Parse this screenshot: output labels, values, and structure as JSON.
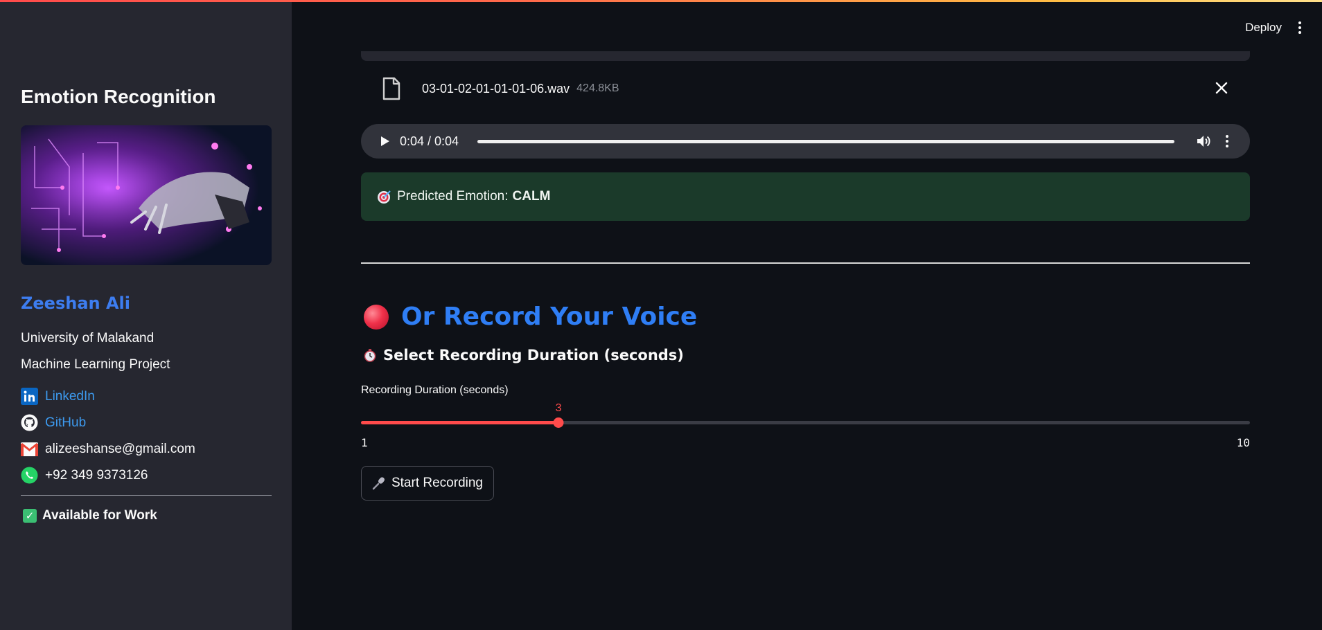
{
  "sidebar": {
    "title": "Emotion Recognition",
    "name": "Zeeshan Ali",
    "university": "University of Malakand",
    "project": "Machine Learning Project",
    "links": {
      "linkedin": "LinkedIn",
      "github": "GitHub",
      "email": "alizeeshanse@gmail.com",
      "phone": "+92 349 9373126"
    },
    "availability": "Available for Work"
  },
  "header": {
    "deploy_label": "Deploy"
  },
  "uploader": {
    "file_name": "03-01-02-01-01-01-06.wav",
    "file_size": "424.8KB"
  },
  "audio": {
    "time": "0:04 / 0:04",
    "progress_fraction": 1.0
  },
  "prediction": {
    "label": "Predicted Emotion:",
    "value": "CALM"
  },
  "record": {
    "heading": "Or Record Your Voice",
    "subheading": "Select Recording Duration (seconds)",
    "slider_label": "Recording Duration (seconds)",
    "slider_value": "3",
    "slider_min": "1",
    "slider_max": "10",
    "button_label": "Start Recording"
  },
  "colors": {
    "accent_red": "#ff4b4b",
    "heading_blue": "#2f7ef5",
    "success_bg": "#1b3a2a",
    "sidebar_bg": "#262730",
    "main_bg": "#0e1117"
  }
}
